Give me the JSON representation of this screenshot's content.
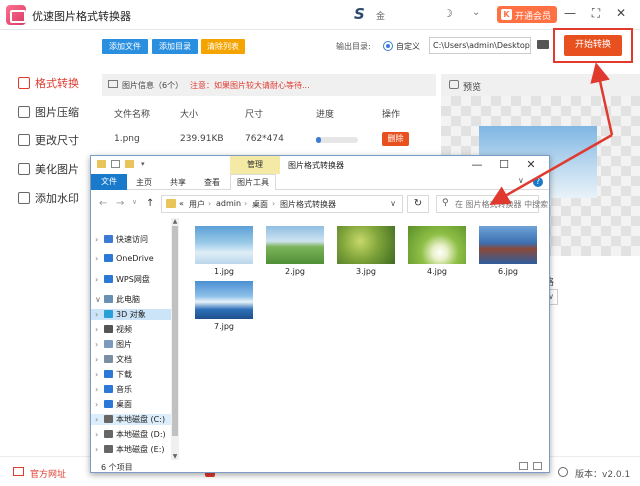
{
  "app": {
    "title": "优速图片格式转换器",
    "vip_label": "开通会员",
    "vip_icon_char": "K",
    "user_glyph": "金",
    "s_glyph": "S",
    "moon_glyph": "☽",
    "chevron_glyph": "⌄"
  },
  "sidebar": {
    "items": [
      {
        "label": "格式转换",
        "icon": "format-convert-icon"
      },
      {
        "label": "图片压缩",
        "icon": "compress-icon"
      },
      {
        "label": "更改尺寸",
        "icon": "resize-icon"
      },
      {
        "label": "美化图片",
        "icon": "beautify-icon"
      },
      {
        "label": "添加水印",
        "icon": "watermark-icon"
      }
    ]
  },
  "toolbar": {
    "add_file": "添加文件",
    "add_dir": "添加目录",
    "clear_list": "清除列表",
    "output_label": "输出目录:",
    "custom_label": "自定义",
    "output_path": "C:\\Users\\admin\\Desktop",
    "start_label": "开始转换"
  },
  "info": {
    "label": "图片信息（6个）",
    "note": "注意：如果图片较大请耐心等待..."
  },
  "table": {
    "headers": [
      "文件名称",
      "大小",
      "尺寸",
      "进度",
      "操作"
    ],
    "rows": [
      {
        "name": "1.png",
        "size": "239.91KB",
        "dims": "762*474",
        "progress": 0.12,
        "action": "删除"
      }
    ]
  },
  "preview": {
    "label": "预览",
    "side_label": "格",
    "side_dropdown": "∨"
  },
  "footer": {
    "home_label": "官方网址",
    "version_label": "版本：v2.0.1"
  },
  "explorer": {
    "title": "图片格式转换器",
    "manage_tab": "管理",
    "tabs": [
      "文件",
      "主页",
      "共享",
      "查看",
      "图片工具"
    ],
    "breadcrumb": [
      "«",
      "用户",
      "admin",
      "桌面",
      "图片格式转换器"
    ],
    "search_placeholder": "在 图片格式转换器 中搜索",
    "nav_items": [
      {
        "label": "快速访问",
        "color": "#3a7bd5"
      },
      {
        "label": "OneDrive",
        "color": "#2b78d6"
      },
      {
        "label": "WPS网盘",
        "color": "#2b78d6"
      },
      {
        "label": "此电脑",
        "color": "#6a8fb5"
      },
      {
        "label": "3D 对象",
        "color": "#2aa0d8"
      },
      {
        "label": "视频",
        "color": "#555555"
      },
      {
        "label": "图片",
        "color": "#7a9bbd"
      },
      {
        "label": "文档",
        "color": "#7a8fa3"
      },
      {
        "label": "下载",
        "color": "#2b78d6"
      },
      {
        "label": "音乐",
        "color": "#2b78d6"
      },
      {
        "label": "桌面",
        "color": "#2b78d6"
      },
      {
        "label": "本地磁盘 (C:)",
        "color": "#666666"
      },
      {
        "label": "本地磁盘 (D:)",
        "color": "#666666"
      },
      {
        "label": "本地磁盘 (E:)",
        "color": "#666666"
      }
    ],
    "files": [
      {
        "name": "1.jpg"
      },
      {
        "name": "2.jpg"
      },
      {
        "name": "3.jpg"
      },
      {
        "name": "4.jpg"
      },
      {
        "name": "6.jpg"
      },
      {
        "name": "7.jpg"
      }
    ],
    "status": "6 个项目"
  },
  "colors": {
    "accent_red": "#e03a2f",
    "start_orange": "#e8501f",
    "btn_blue": "#2b8fe0",
    "btn_orange": "#f4a400",
    "explorer_blue": "#1979ca"
  }
}
